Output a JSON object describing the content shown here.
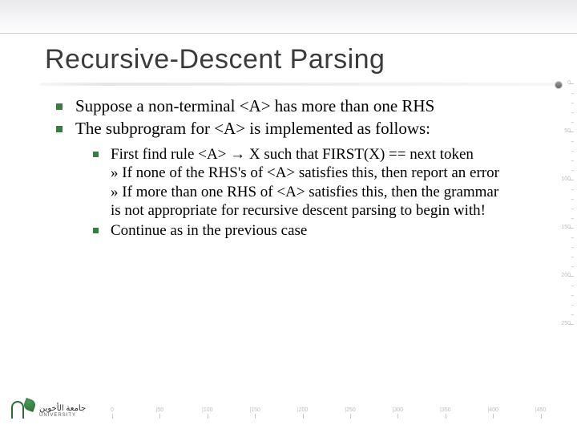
{
  "title": "Recursive-Descent Parsing",
  "bullets_lvl1": [
    "Suppose a non-terminal <A> has more than one RHS",
    "The subprogram for <A> is implemented as follows:"
  ],
  "bullets_lvl2": [
    "First find rule <A> → X  such that FIRST(X) == next token\n» If none of the RHS's of <A> satisfies this, then report an error\n» If more than one RHS of <A> satisfies this, then the grammar is not appropriate for recursive descent parsing to begin with!",
    "Continue as in the previous case"
  ],
  "hruler_labels": [
    "0",
    "|50",
    "|100",
    "|150",
    "|200",
    "|250",
    "|300",
    "|350",
    "|400",
    "|450"
  ],
  "vruler_labels": [
    "0",
    "50",
    "100",
    "150",
    "200",
    "250"
  ],
  "logo": {
    "ar": "جامعة الأخوين",
    "en": "UNIVERSITY"
  }
}
